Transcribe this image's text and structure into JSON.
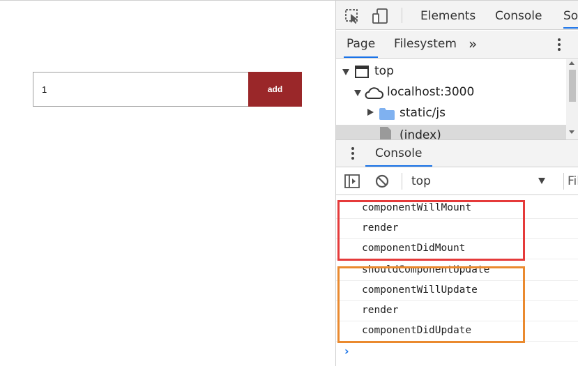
{
  "app": {
    "input_value": "1",
    "add_label": "add",
    "add_color": "#9a2729"
  },
  "devtools": {
    "toolbar": {
      "inspect_icon": "inspect-element-icon",
      "device_icon": "device-toolbar-icon",
      "tabs": [
        "Elements",
        "Console",
        "So"
      ]
    },
    "navigator": {
      "tabs": [
        "Page",
        "Filesystem"
      ],
      "overflow": "»",
      "tree": [
        {
          "label": "top",
          "icon": "window-icon"
        },
        {
          "label": "localhost:3000",
          "icon": "cloud-icon"
        },
        {
          "label": "static/js",
          "icon": "folder-icon"
        },
        {
          "label": "(index)",
          "icon": "file-icon"
        }
      ]
    },
    "drawer": {
      "tab": "Console"
    },
    "console_toolbar": {
      "context": "top",
      "filter_placeholder": "Filter"
    },
    "messages": [
      "componentWillMount",
      "render",
      "componentDidMount",
      "shouldComponentUpdate",
      "componentWillUpdate",
      "render",
      "componentDidUpdate"
    ],
    "prompt": "›",
    "highlight_colors": {
      "mount_group": "#e53a3a",
      "update_group": "#ea8a2f"
    }
  }
}
